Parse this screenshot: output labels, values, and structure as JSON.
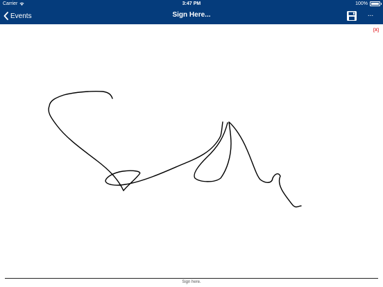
{
  "status_bar": {
    "carrier": "Carrier",
    "time": "3:47 PM",
    "battery": "100%"
  },
  "nav": {
    "back_label": "Events",
    "title": "Sign Here...",
    "more_label": "..."
  },
  "canvas": {
    "clear_label": "[X]",
    "signature_line_label": "Sign here."
  },
  "icons": {
    "back": "chevron-left-icon",
    "save": "floppy-disk-icon",
    "wifi": "wifi-icon",
    "battery": "battery-icon"
  },
  "colors": {
    "header": "#053c7c",
    "clear": "#e3262a",
    "ink": "#000000"
  }
}
